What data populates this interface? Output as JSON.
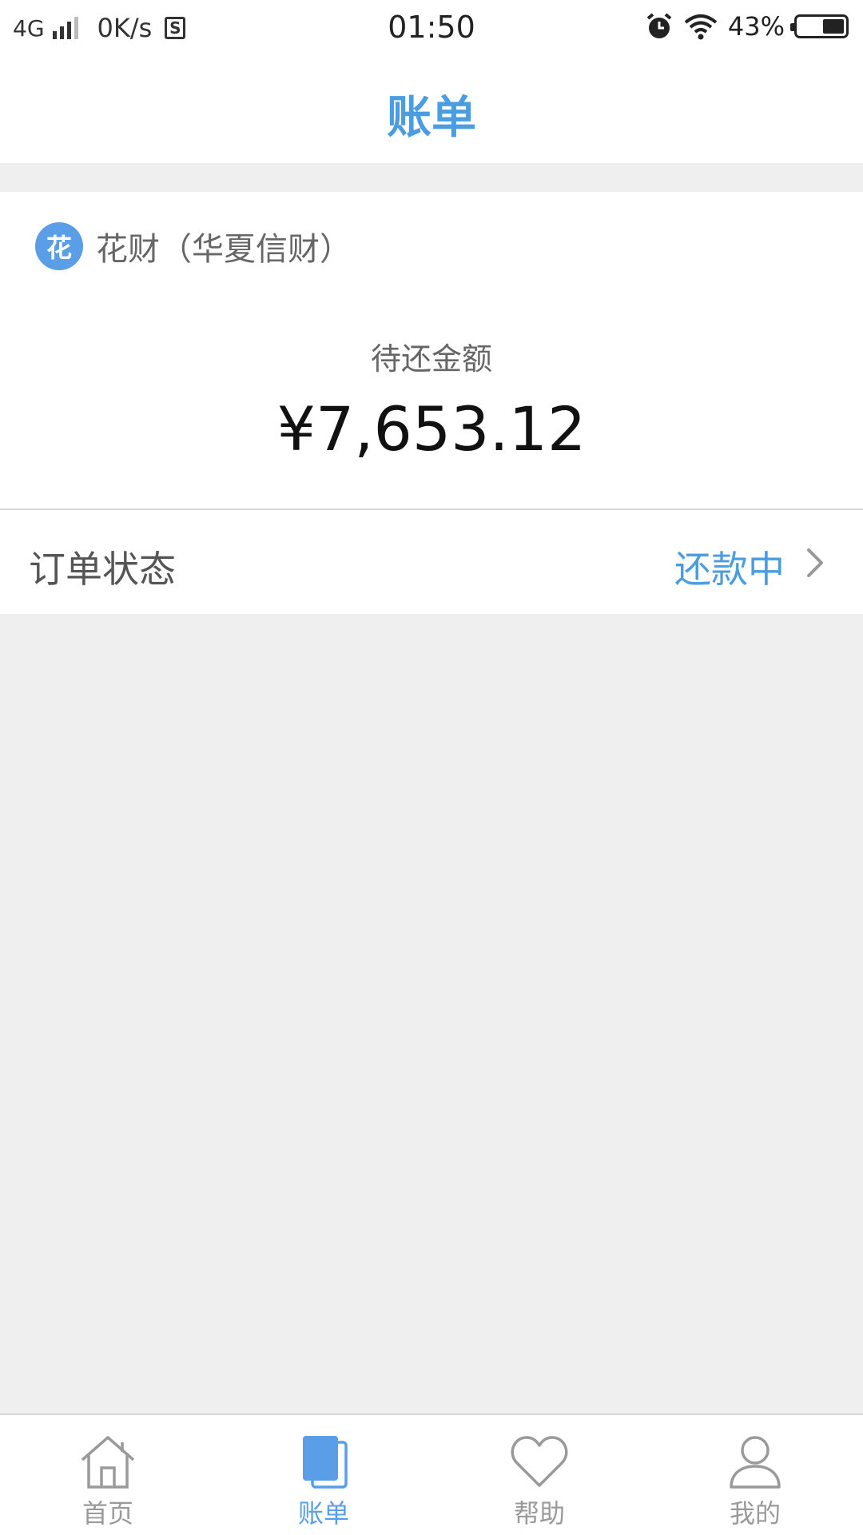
{
  "status_bar": {
    "network": "4G",
    "speed": "0K/s",
    "storage_icon_letter": "S",
    "time": "01:50",
    "battery": "43%",
    "icons": [
      "signal-icon",
      "storage-icon",
      "alarm-icon",
      "wifi-icon",
      "battery-icon"
    ]
  },
  "header": {
    "title": "账单"
  },
  "bill": {
    "lender_badge": "花",
    "lender_name": "花财（华夏信财）",
    "amount_label": "待还金额",
    "amount_value": "¥7,653.12"
  },
  "order": {
    "label": "订单状态",
    "status": "还款中"
  },
  "tab_bar": {
    "active_index": 1,
    "items": [
      {
        "label": "首页",
        "icon": "home-icon"
      },
      {
        "label": "账单",
        "icon": "bill-icon"
      },
      {
        "label": "帮助",
        "icon": "heart-icon"
      },
      {
        "label": "我的",
        "icon": "user-icon"
      }
    ]
  },
  "colors": {
    "accent": "#4a9de0",
    "badge": "#5b9ee8",
    "tab_active": "#5b9ee8",
    "tab_inactive": "#9a9a9a",
    "page_bg": "#efefef"
  }
}
